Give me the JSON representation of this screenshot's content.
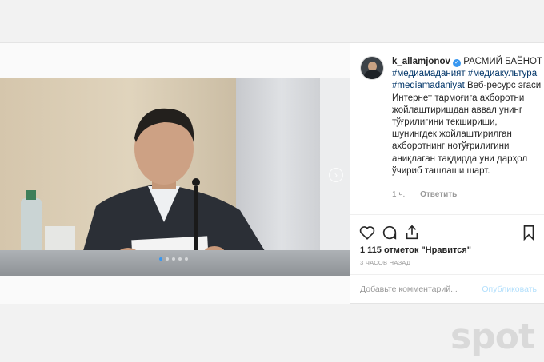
{
  "post": {
    "username": "k_allamjonov",
    "title_text": "РАСМИЙ БАЁНОТ",
    "hashtags": "#медиамаданият #медиакультура #mediamadaniyat",
    "body": "Веб-ресурс эгаси Интернет тармоғига ахборотни жойлаштиришдан аввал унинг тўғрилигини текшириши, шунингдек жойлаштирилган ахборотнинг нотўғрилигини аниқлаган тақдирда уни дарҳол ўчириб ташлаши шарт.",
    "comment_age": "1 ч.",
    "reply_label": "Ответить",
    "likes": "1 115 отметок \"Нравится\"",
    "posted_ago": "3 ЧАСОВ НАЗАД",
    "comment_placeholder": "Добавьте комментарий...",
    "publish_label": "Опубликовать"
  },
  "carousel": {
    "slides": 5,
    "active_index": 0
  },
  "icons": {
    "like": "heart-icon",
    "comment": "comment-icon",
    "share": "share-icon",
    "save": "bookmark-icon",
    "next": "chevron-right-icon"
  },
  "colors": {
    "link": "#003569",
    "verified": "#3897f0",
    "publish_disabled": "#b2dffc"
  },
  "watermark": "spot"
}
